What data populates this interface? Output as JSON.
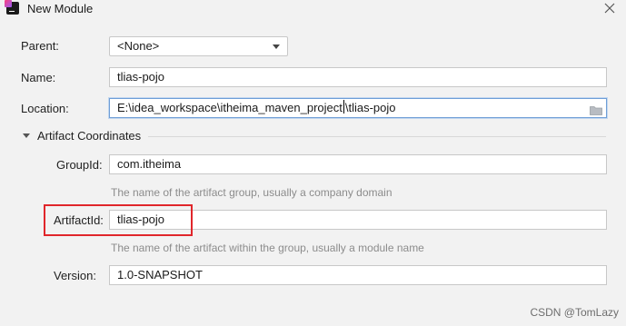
{
  "window": {
    "title": "New Module"
  },
  "form": {
    "parent": {
      "label": "Parent:",
      "value": "<None>"
    },
    "name": {
      "label": "Name:",
      "value": "tlias-pojo"
    },
    "location": {
      "label": "Location:",
      "value_before_caret": "E:\\idea_workspace\\itheima_maven_project",
      "value_after_caret": "\\tlias-pojo"
    },
    "artifact_section": {
      "label": "Artifact Coordinates"
    },
    "group_id": {
      "label": "GroupId:",
      "value": "com.itheima",
      "hint": "The name of the artifact group, usually a company domain"
    },
    "artifact_id": {
      "label": "ArtifactId:",
      "value": "tlias-pojo",
      "hint": "The name of the artifact within the group, usually a module name"
    },
    "version": {
      "label": "Version:",
      "value": "1.0-SNAPSHOT"
    }
  },
  "watermark": "CSDN @TomLazy",
  "colors": {
    "highlight": "#e0262b",
    "focus_border": "#6f9ed7",
    "hint_text": "#8c8c8c"
  }
}
